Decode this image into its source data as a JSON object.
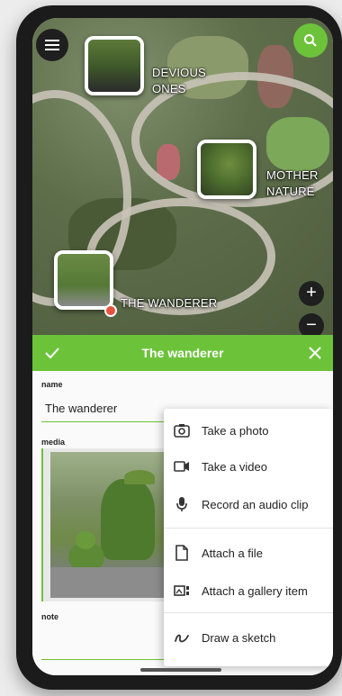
{
  "map": {
    "markers": [
      {
        "label_line1": "DEVIOUS",
        "label_line2": "ONES"
      },
      {
        "label_line1": "MOTHER",
        "label_line2": "NATURE"
      },
      {
        "label_line1": "THE WANDERER",
        "label_line2": ""
      }
    ],
    "zoom_in": "+",
    "zoom_out": "−"
  },
  "sheet": {
    "title": "The wanderer",
    "accent": "#6cc33a"
  },
  "form": {
    "name_label": "name",
    "name_value": "The wanderer",
    "media_label": "media",
    "note_label": "note"
  },
  "popup": {
    "items": [
      {
        "label": "Take a photo",
        "icon": "camera-icon"
      },
      {
        "label": "Take a video",
        "icon": "video-camera-icon"
      },
      {
        "label": "Record an audio clip",
        "icon": "microphone-icon"
      },
      {
        "label": "Attach a file",
        "icon": "file-icon"
      },
      {
        "label": "Attach a gallery item",
        "icon": "gallery-icon"
      },
      {
        "label": "Draw a sketch",
        "icon": "pen-squiggle-icon"
      }
    ]
  }
}
